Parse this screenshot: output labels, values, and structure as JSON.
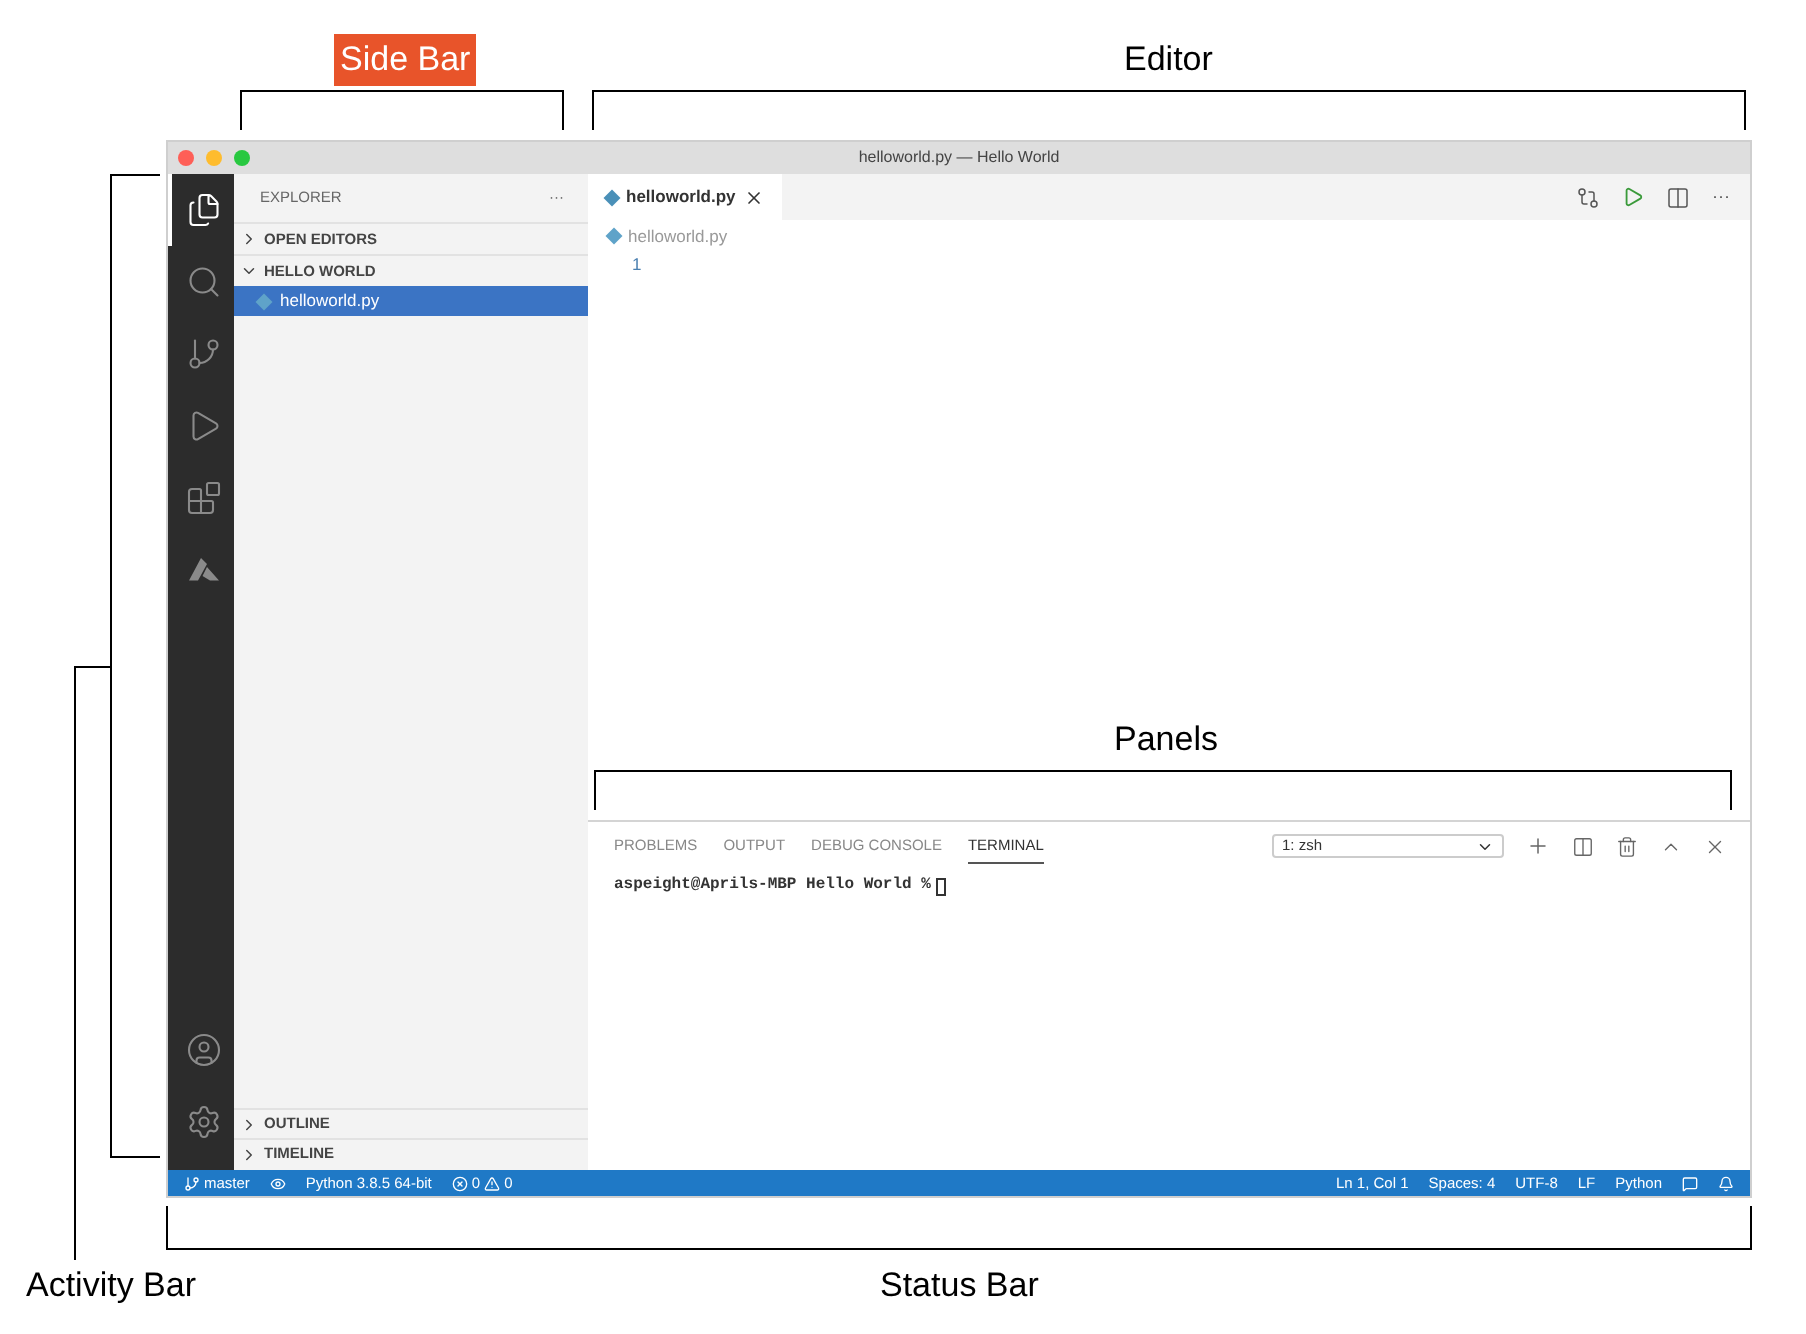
{
  "window": {
    "title": "helloworld.py — Hello World"
  },
  "activity_bar": {
    "items": [
      {
        "kind": "files",
        "selected": true
      },
      {
        "kind": "search",
        "selected": false
      },
      {
        "kind": "source-control",
        "selected": false
      },
      {
        "kind": "run",
        "selected": false
      },
      {
        "kind": "extensions",
        "selected": false
      },
      {
        "kind": "azure",
        "selected": false
      }
    ],
    "bottom_items": [
      {
        "kind": "account",
        "selected": false
      },
      {
        "kind": "settings",
        "selected": false
      }
    ]
  },
  "sidebar": {
    "title": "EXPLORER",
    "more": "···",
    "sections": [
      {
        "label": "OPEN EDITORS",
        "expanded": false
      },
      {
        "label": "HELLO WORLD",
        "expanded": true,
        "children": [
          {
            "label": "helloworld.py",
            "selected": true
          }
        ]
      }
    ],
    "bottom_sections": [
      {
        "label": "OUTLINE",
        "expanded": false
      },
      {
        "label": "TIMELINE",
        "expanded": false
      }
    ]
  },
  "editor": {
    "tabs": [
      {
        "label": "helloworld.py",
        "selected": true
      }
    ],
    "more": "···",
    "breadcrumb": "helloworld.py",
    "line_numbers": [
      "1"
    ]
  },
  "panel": {
    "tabs": [
      {
        "label": "PROBLEMS",
        "selected": false
      },
      {
        "label": "OUTPUT",
        "selected": false
      },
      {
        "label": "DEBUG CONSOLE",
        "selected": false
      },
      {
        "label": "TERMINAL",
        "selected": true
      }
    ],
    "terminal_select": "1: zsh",
    "terminal_prompt": "aspeight@Aprils-MBP Hello World %"
  },
  "status_bar": {
    "branch": "master",
    "interpreter": "Python 3.8.5 64-bit",
    "errors": "0",
    "warnings": "0",
    "right": [
      "Ln 1, Col 1",
      "Spaces: 4",
      "UTF-8",
      "LF",
      "Python"
    ]
  },
  "annotations": [
    {
      "label": "Side Bar",
      "highlighted": true
    },
    {
      "label": "Editor",
      "highlighted": false
    },
    {
      "label": "Panels",
      "highlighted": false
    },
    {
      "label": "Activity Bar",
      "highlighted": false
    },
    {
      "label": "Status Bar",
      "highlighted": false
    }
  ]
}
